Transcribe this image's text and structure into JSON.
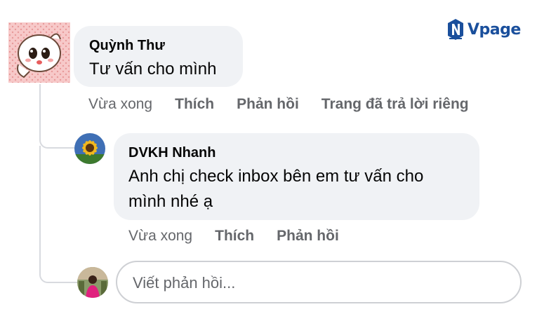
{
  "brand": {
    "name": "Vpage",
    "color": "#1a4f9c"
  },
  "comments": [
    {
      "author": "Quỳnh Thư",
      "text": "Tư vấn cho mình",
      "time": "Vừa xong",
      "actions": [
        "Thích",
        "Phản hồi",
        "Trang đã trả lời riêng"
      ],
      "avatar_icon": "cartoon-sticker-avatar"
    },
    {
      "author": "DVKH Nhanh",
      "text_lines": [
        "Anh chị check inbox bên em tư vấn cho",
        "mình nhé ạ"
      ],
      "time": "Vừa xong",
      "actions": [
        "Thích",
        "Phản hồi"
      ],
      "avatar_icon": "sunflower-avatar"
    }
  ],
  "reply_box": {
    "placeholder": "Viết phản hồi...",
    "value": "",
    "avatar_icon": "user-photo-avatar"
  },
  "colors": {
    "bubble": "#f0f2f5",
    "secondary_text": "#65676b",
    "border": "#ced0d4"
  }
}
